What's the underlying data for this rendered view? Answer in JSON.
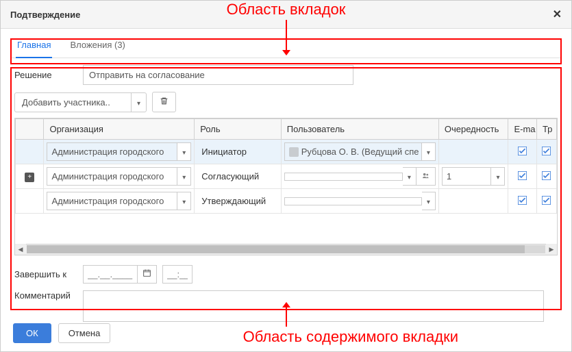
{
  "dialog": {
    "title": "Подтверждение"
  },
  "annotations": {
    "tabs_area": "Область вкладок",
    "content_area": "Область содержимого вкладки"
  },
  "tabs": [
    {
      "label": "Главная",
      "active": true
    },
    {
      "label": "Вложения (3)",
      "active": false
    }
  ],
  "decision": {
    "label": "Решение",
    "value": "Отправить на согласование"
  },
  "participants_toolbar": {
    "add_label": "Добавить участника.."
  },
  "grid": {
    "columns": {
      "org": "Организация",
      "role": "Роль",
      "user": "Пользователь",
      "order": "Очередность",
      "email": "E-ma",
      "tr": "Тр"
    },
    "rows": [
      {
        "expand": false,
        "org": "Администрация городского",
        "role": "Инициатор",
        "user": "Рубцова О. В. (Ведущий спе",
        "order": "",
        "order_editable": false,
        "email_checked": true,
        "tr_checked": true,
        "highlight": true
      },
      {
        "expand": true,
        "org": "Администрация городского",
        "role": "Согласующий",
        "user": "",
        "order": "1",
        "order_editable": true,
        "email_checked": true,
        "tr_checked": true,
        "highlight": false
      },
      {
        "expand": false,
        "org": "Администрация городского",
        "role": "Утверждающий",
        "user": "",
        "order": "",
        "order_editable": false,
        "email_checked": true,
        "tr_checked": true,
        "highlight": false
      }
    ]
  },
  "complete_by": {
    "label": "Завершить к",
    "date_placeholder": "__.__.____",
    "time_placeholder": "__:__"
  },
  "comment": {
    "label": "Комментарий"
  },
  "buttons": {
    "ok": "ОК",
    "cancel": "Отмена"
  }
}
